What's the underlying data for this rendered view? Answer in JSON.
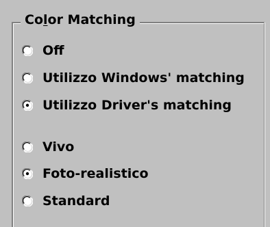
{
  "group": {
    "title_prefix": "Co",
    "title_mnemonic": "l",
    "title_suffix": "or Matching"
  },
  "matching_options": [
    {
      "label": "Off",
      "selected": false
    },
    {
      "label": "Utilizzo Windows' matching",
      "selected": false
    },
    {
      "label": "Utilizzo Driver's matching",
      "selected": true
    }
  ],
  "rendering_options": [
    {
      "label": "Vivo",
      "selected": false
    },
    {
      "label": "Foto-realistico",
      "selected": true
    },
    {
      "label": "Standard",
      "selected": false
    }
  ]
}
